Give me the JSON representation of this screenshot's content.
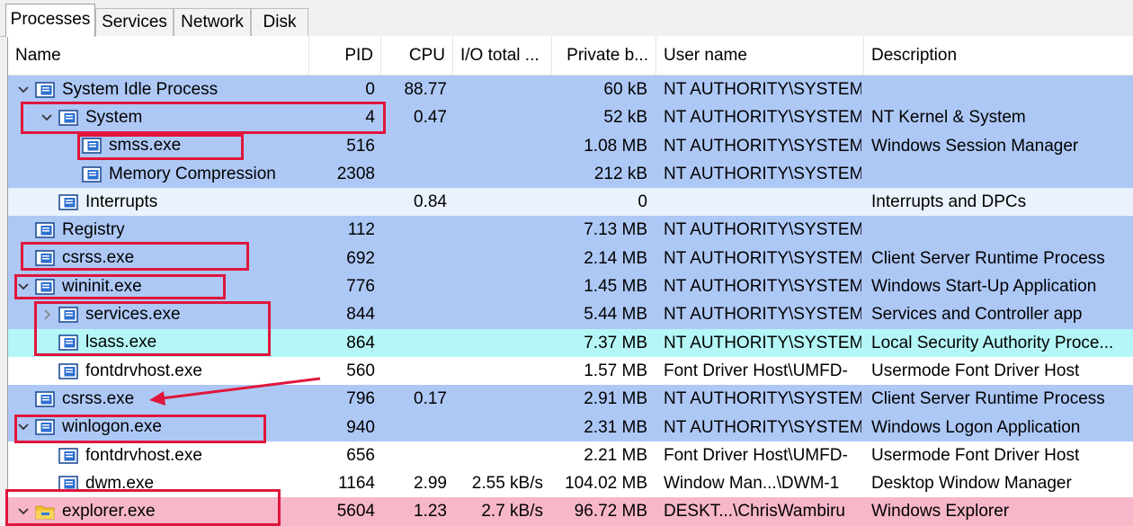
{
  "tabs": [
    {
      "label": "Processes",
      "active": true
    },
    {
      "label": "Services",
      "active": false
    },
    {
      "label": "Network",
      "active": false
    },
    {
      "label": "Disk",
      "active": false
    }
  ],
  "columns": {
    "name": "Name",
    "pid": "PID",
    "cpu": "CPU",
    "io": "I/O total ...",
    "private": "Private b...",
    "user": "User name",
    "desc": "Description"
  },
  "colors": {
    "blue_row": "#aec8f6",
    "light_row": "#eaf2fd",
    "white_row": "#ffffff",
    "cyan_row": "#b5f6f6",
    "pink_row": "#f7b7c9",
    "annotation": "#e0163c"
  },
  "processes": [
    {
      "name": "System Idle Process",
      "pid": "0",
      "cpu": "88.77",
      "io": "",
      "private": "60 kB",
      "user": "NT AUTHORITY\\SYSTEM",
      "desc": "",
      "indent": 0,
      "chevron": "down",
      "icon": "process-icon",
      "bg": "blue"
    },
    {
      "name": "System",
      "pid": "4",
      "cpu": "0.47",
      "io": "",
      "private": "52 kB",
      "user": "NT AUTHORITY\\SYSTEM",
      "desc": "NT Kernel & System",
      "indent": 1,
      "chevron": "down",
      "icon": "process-icon",
      "bg": "blue"
    },
    {
      "name": "smss.exe",
      "pid": "516",
      "cpu": "",
      "io": "",
      "private": "1.08 MB",
      "user": "NT AUTHORITY\\SYSTEM",
      "desc": "Windows Session Manager",
      "indent": 2,
      "chevron": "none",
      "icon": "process-icon",
      "bg": "blue"
    },
    {
      "name": "Memory Compression",
      "pid": "2308",
      "cpu": "",
      "io": "",
      "private": "212 kB",
      "user": "NT AUTHORITY\\SYSTEM",
      "desc": "",
      "indent": 2,
      "chevron": "none",
      "icon": "process-icon",
      "bg": "blue"
    },
    {
      "name": "Interrupts",
      "pid": "",
      "cpu": "0.84",
      "io": "",
      "private": "0",
      "user": "",
      "desc": "Interrupts and DPCs",
      "indent": 1,
      "chevron": "none",
      "icon": "process-icon",
      "bg": "light"
    },
    {
      "name": "Registry",
      "pid": "112",
      "cpu": "",
      "io": "",
      "private": "7.13 MB",
      "user": "NT AUTHORITY\\SYSTEM",
      "desc": "",
      "indent": 0,
      "chevron": "none",
      "icon": "process-icon",
      "bg": "blue"
    },
    {
      "name": "csrss.exe",
      "pid": "692",
      "cpu": "",
      "io": "",
      "private": "2.14 MB",
      "user": "NT AUTHORITY\\SYSTEM",
      "desc": "Client Server Runtime Process",
      "indent": 0,
      "chevron": "none",
      "icon": "process-icon",
      "bg": "blue"
    },
    {
      "name": "wininit.exe",
      "pid": "776",
      "cpu": "",
      "io": "",
      "private": "1.45 MB",
      "user": "NT AUTHORITY\\SYSTEM",
      "desc": "Windows Start-Up Application",
      "indent": 0,
      "chevron": "down",
      "icon": "process-icon",
      "bg": "blue"
    },
    {
      "name": "services.exe",
      "pid": "844",
      "cpu": "",
      "io": "",
      "private": "5.44 MB",
      "user": "NT AUTHORITY\\SYSTEM",
      "desc": "Services and Controller app",
      "indent": 1,
      "chevron": "right",
      "icon": "process-icon",
      "bg": "blue"
    },
    {
      "name": "lsass.exe",
      "pid": "864",
      "cpu": "",
      "io": "",
      "private": "7.37 MB",
      "user": "NT AUTHORITY\\SYSTEM",
      "desc": "Local Security Authority Proce...",
      "indent": 1,
      "chevron": "none",
      "icon": "process-icon",
      "bg": "cyan"
    },
    {
      "name": "fontdrvhost.exe",
      "pid": "560",
      "cpu": "",
      "io": "",
      "private": "1.57 MB",
      "user": "Font Driver Host\\UMFD-",
      "desc": "Usermode Font Driver Host",
      "indent": 1,
      "chevron": "none",
      "icon": "process-icon",
      "bg": "white"
    },
    {
      "name": "csrss.exe",
      "pid": "796",
      "cpu": "0.17",
      "io": "",
      "private": "2.91 MB",
      "user": "NT AUTHORITY\\SYSTEM",
      "desc": "Client Server Runtime Process",
      "indent": 0,
      "chevron": "none",
      "icon": "process-icon",
      "bg": "blue"
    },
    {
      "name": "winlogon.exe",
      "pid": "940",
      "cpu": "",
      "io": "",
      "private": "2.31 MB",
      "user": "NT AUTHORITY\\SYSTEM",
      "desc": "Windows Logon Application",
      "indent": 0,
      "chevron": "down",
      "icon": "process-icon",
      "bg": "blue"
    },
    {
      "name": "fontdrvhost.exe",
      "pid": "656",
      "cpu": "",
      "io": "",
      "private": "2.21 MB",
      "user": "Font Driver Host\\UMFD-",
      "desc": "Usermode Font Driver Host",
      "indent": 1,
      "chevron": "none",
      "icon": "process-icon",
      "bg": "white"
    },
    {
      "name": "dwm.exe",
      "pid": "1164",
      "cpu": "2.99",
      "io": "2.55 kB/s",
      "private": "104.02 MB",
      "user": "Window Man...\\DWM-1",
      "desc": "Desktop Window Manager",
      "indent": 1,
      "chevron": "none",
      "icon": "process-icon",
      "bg": "white"
    },
    {
      "name": "explorer.exe",
      "pid": "5604",
      "cpu": "1.23",
      "io": "2.7 kB/s",
      "private": "96.72 MB",
      "user": "DESKT...\\ChrisWambiru",
      "desc": "Windows Explorer",
      "indent": 0,
      "chevron": "down",
      "icon": "folder-icon",
      "bg": "pink"
    }
  ]
}
